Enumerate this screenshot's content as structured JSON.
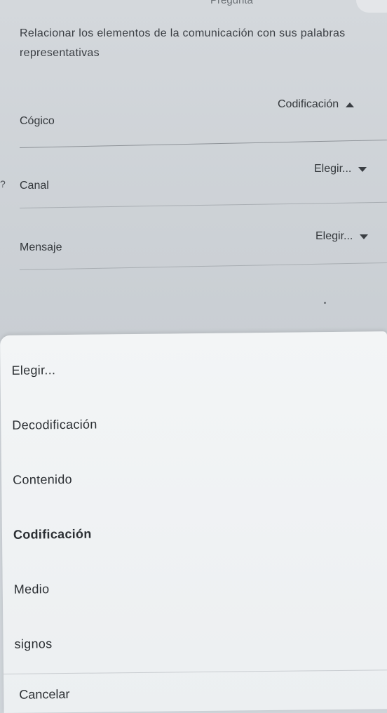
{
  "header": {
    "title": "Pregunta"
  },
  "question": {
    "instruction": "Relacionar los elementos de la comunicación con sus palabras representativas"
  },
  "matches": [
    {
      "label": "Cógico",
      "selected": "Codificación",
      "expanded": true
    },
    {
      "label": "Canal",
      "selected": "Elegir...",
      "expanded": false
    },
    {
      "label": "Mensaje",
      "selected": "Elegir...",
      "expanded": false
    }
  ],
  "row_marker": "?",
  "dropdown": {
    "options": [
      {
        "label": "Elegir...",
        "selected": false
      },
      {
        "label": "Decodificación",
        "selected": false
      },
      {
        "label": "Contenido",
        "selected": false
      },
      {
        "label": "Codificación",
        "selected": true
      },
      {
        "label": "Medio",
        "selected": false
      },
      {
        "label": "signos",
        "selected": false
      }
    ],
    "cancel_label": "Cancelar"
  },
  "icons": {
    "expanded_caret": "caret-up-icon",
    "collapsed_caret": "caret-down-icon"
  }
}
